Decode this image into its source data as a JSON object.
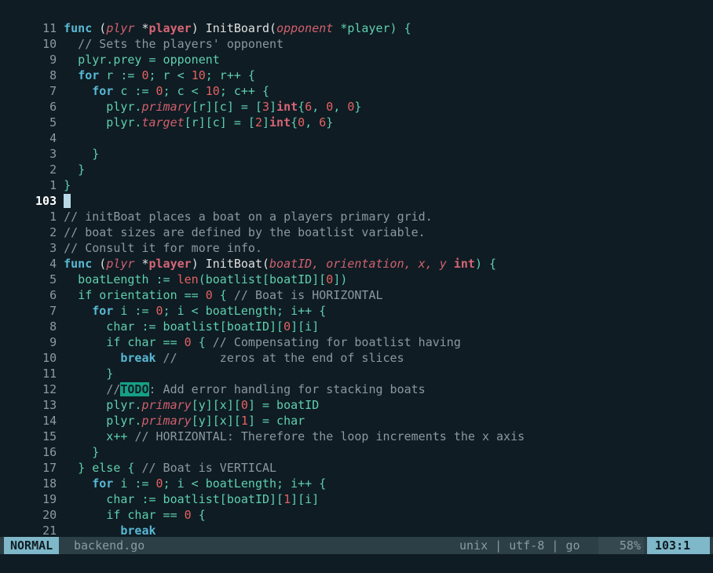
{
  "editor": {
    "mode": "NORMAL",
    "filename": "backend.go",
    "fileformat": "unix",
    "encoding": "utf-8",
    "filetype": "go",
    "separator": "|",
    "scroll_percent": "58%",
    "cursor_position": "103:1"
  },
  "line_numbers": [
    "11",
    "10",
    "9",
    "8",
    "7",
    "6",
    "5",
    "4",
    "3",
    "2",
    "1",
    "103",
    "1",
    "2",
    "3",
    "4",
    "5",
    "6",
    "7",
    "8",
    "9",
    "10",
    "11",
    "12",
    "13",
    "14",
    "15",
    "16",
    "17",
    "18",
    "19",
    "20",
    "21",
    "22"
  ],
  "code": {
    "l0_kw": "func",
    "l0_p1": " (",
    "l0_recv": "plyr",
    "l0_star": " *",
    "l0_type": "player",
    "l0_p2": ") InitBoard(",
    "l0_arg": "opponent",
    "l0_p3": " *player) {",
    "l1": "  // Sets the players' opponent",
    "l2": "  plyr.prey = opponent",
    "l3_indent": "  ",
    "l3_kw": "for",
    "l3_a": " r := ",
    "l3_n1": "0",
    "l3_b": "; r < ",
    "l3_n2": "10",
    "l3_c": "; r++ {",
    "l4_indent": "    ",
    "l4_kw": "for",
    "l4_a": " c := ",
    "l4_n1": "0",
    "l4_b": "; c < ",
    "l4_n2": "10",
    "l4_c": "; c++ {",
    "l5_a": "      plyr.",
    "l5_field": "primary",
    "l5_b": "[r][c] = [",
    "l5_n": "3",
    "l5_c": "]",
    "l5_type": "int",
    "l5_d": "{",
    "l5_v1": "6",
    "l5_e": ", ",
    "l5_v2": "0",
    "l5_f": ", ",
    "l5_v3": "0",
    "l5_g": "}",
    "l6_a": "      plyr.",
    "l6_field": "target",
    "l6_b": "[r][c] = [",
    "l6_n": "2",
    "l6_c": "]",
    "l6_type": "int",
    "l6_d": "{",
    "l6_v1": "0",
    "l6_e": ", ",
    "l6_v2": "6",
    "l6_f": "}",
    "l8": "    }",
    "l9": "  }",
    "l10": "}",
    "l12": "// initBoat places a boat on a players primary grid.",
    "l13": "// boat sizes are defined by the boatlist variable.",
    "l14": "// Consult it for more info.",
    "l15_kw": "func",
    "l15_p1": " (",
    "l15_recv": "plyr",
    "l15_star": " *",
    "l15_type": "player",
    "l15_p2": ") InitBoat(",
    "l15_args": "boatID, orientation, x, y",
    "l15_sp": " ",
    "l15_int": "int",
    "l15_p3": ") {",
    "l16_a": "  boatLength := ",
    "l16_len": "len",
    "l16_b": "(boatlist[boatID][",
    "l16_n": "0",
    "l16_c": "])",
    "l17_indent": "  ",
    "l17_kw": "if",
    "l17_a": " orientation == ",
    "l17_n": "0",
    "l17_b": " { ",
    "l17_cm": "// Boat is HORIZONTAL",
    "l18_indent": "    ",
    "l18_kw": "for",
    "l18_a": " i := ",
    "l18_n": "0",
    "l18_b": "; i < boatLength; i++ {",
    "l19_a": "      char := boatlist[boatID][",
    "l19_n": "0",
    "l19_b": "][i]",
    "l20_indent": "      ",
    "l20_kw": "if",
    "l20_a": " char == ",
    "l20_n": "0",
    "l20_b": " { ",
    "l20_cm": "// Compensating for boatlist having",
    "l21_indent": "        ",
    "l21_kw": "break",
    "l21_cm": " //      zeros at the end of slices",
    "l22": "      }",
    "l23_indent": "      ",
    "l23_cm1": "//",
    "l23_todo": "TODO",
    "l23_cm2": ": Add error handling for stacking boats",
    "l24_a": "      plyr.",
    "l24_field": "primary",
    "l24_b": "[y][x][",
    "l24_n": "0",
    "l24_c": "] = boatID",
    "l25_a": "      plyr.",
    "l25_field": "primary",
    "l25_b": "[y][x][",
    "l25_n": "1",
    "l25_c": "] = char",
    "l26_a": "      x++ ",
    "l26_cm": "// HORIZONTAL: Therefore the loop increments the x axis",
    "l27": "    }",
    "l28_a": "  } ",
    "l28_kw": "else",
    "l28_b": " { ",
    "l28_cm": "// Boat is VERTICAL",
    "l29_indent": "    ",
    "l29_kw": "for",
    "l29_a": " i := ",
    "l29_n": "0",
    "l29_b": "; i < boatLength; i++ {",
    "l30_a": "      char := boatlist[boatID][",
    "l30_n": "1",
    "l30_b": "][i]",
    "l31_indent": "      ",
    "l31_kw": "if",
    "l31_a": " char == ",
    "l31_n": "0",
    "l31_b": " {",
    "l32_indent": "        ",
    "l32_kw": "break",
    "l33": "      }"
  },
  "colors": {
    "background": "#0f1c23",
    "keyword": "#59b8d4",
    "number": "#e36262",
    "comment": "#8c98a0",
    "code_text": "#5fcfb0",
    "todo_highlight": "#16a085",
    "mode_badge": "#7eb8c9"
  }
}
